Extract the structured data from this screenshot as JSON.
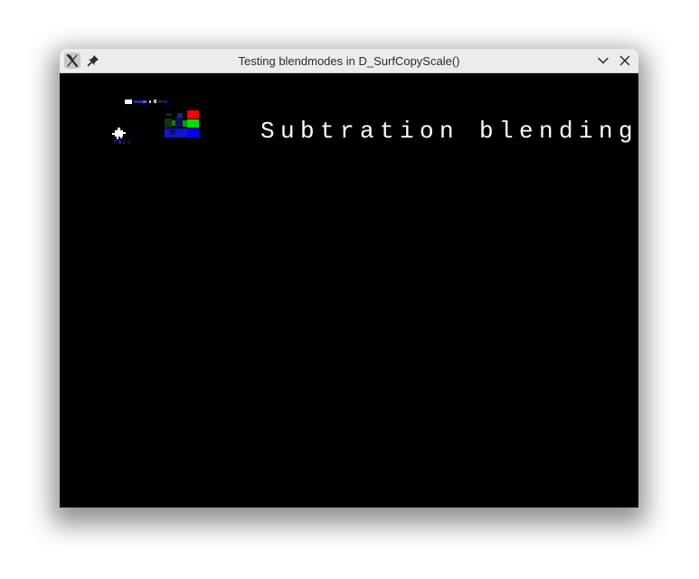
{
  "window": {
    "title": "Testing blendmodes in D_SurfCopyScale()"
  },
  "icons": {
    "app": "x-logo-icon",
    "pin": "pin-icon",
    "minimize": "chevron-down-icon",
    "close": "close-icon"
  },
  "canvas": {
    "background": "#000000",
    "caption": "Subtration blending"
  },
  "colors": {
    "titlebar": "#ececec",
    "red": "#ff0000",
    "green": "#00e000",
    "blue": "#0000ff"
  }
}
